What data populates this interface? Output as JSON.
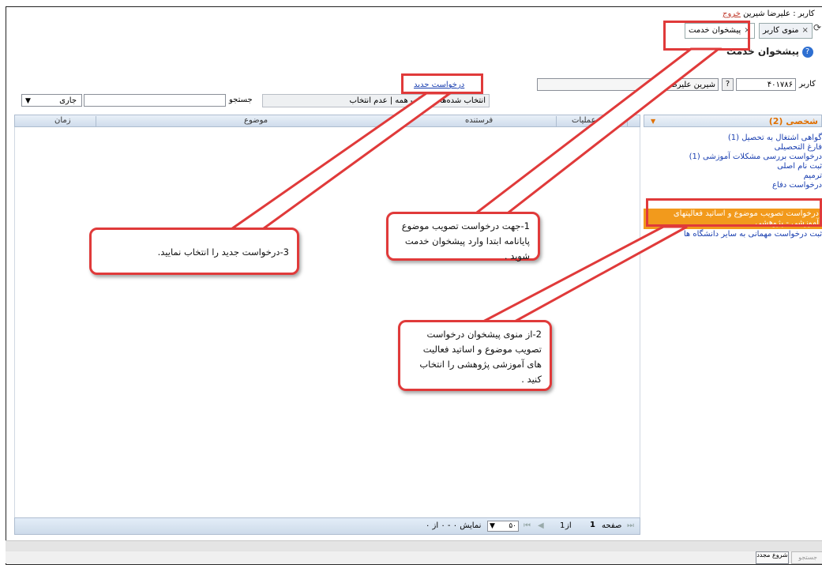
{
  "header": {
    "user_line_label": "کاربر : علیرضا شیرین",
    "logout_link": "خروج"
  },
  "tabs": [
    {
      "label": "منوی کاربر",
      "close_glyph": "×"
    },
    {
      "label": "پیشخوان خدمت",
      "close_glyph": "×"
    }
  ],
  "page_title": "پیشخوان خدمت",
  "user_row": {
    "label": "کاربر",
    "user_code": "۴۰۱۷۸۶",
    "lookup_glyph": "?",
    "user_name": "شیرین علیرضا"
  },
  "new_request_link": "درخواست جدید",
  "toolbar": {
    "selection_links": "انتخاب شده‌ها | انتخاب همه | عدم انتخاب",
    "search_label": "جستجو",
    "search_value": "",
    "status_select": "جاری"
  },
  "grid": {
    "columns": [
      "عملیات",
      "فرستنده",
      "موضوع",
      "زمان"
    ]
  },
  "pager": {
    "page_label": "صفحه",
    "page_number": "1",
    "of_label": "از",
    "of_count": "1",
    "page_size": "۵۰",
    "display_text": "نمایش ۰ - ۰ از ۰"
  },
  "sidebar": {
    "header": "شخصی (2)",
    "items": [
      "گواهی اشتغال به تحصیل (1)",
      "فارغ التحصیلی",
      "درخواست بررسی مشکلات آموزشی (1)",
      "ثبت نام اصلی",
      "ترمیم",
      "درخواست دفاع"
    ],
    "selected_item": "درخواست تصویب موضوع و اساتید فعالیتهای آموزشی - پژوهشی",
    "last_item": "ثبت درخواست مهمانی به سایر دانشگاه ها"
  },
  "callouts": {
    "c1": "1-جهت درخواست تصویب موضوع پایانامه ابتدا وارد پیشخوان خدمت شوید .",
    "c2": "2-از منوی پیشخوان درخواست تصویب موضوع و اساتید فعالیت های آموزشی پژوهشی را انتخاب کنید .",
    "c3": "3-درخواست جدید را انتخاب نمایید."
  },
  "taskbar": {
    "start_label": "شروع مجدد",
    "search_label": "جستجو"
  },
  "colors": {
    "callout_border": "#e03a3a",
    "selected_item_bg": "#f29a1c",
    "link": "#1a3fb0",
    "sidebar_header": "#e07000"
  }
}
